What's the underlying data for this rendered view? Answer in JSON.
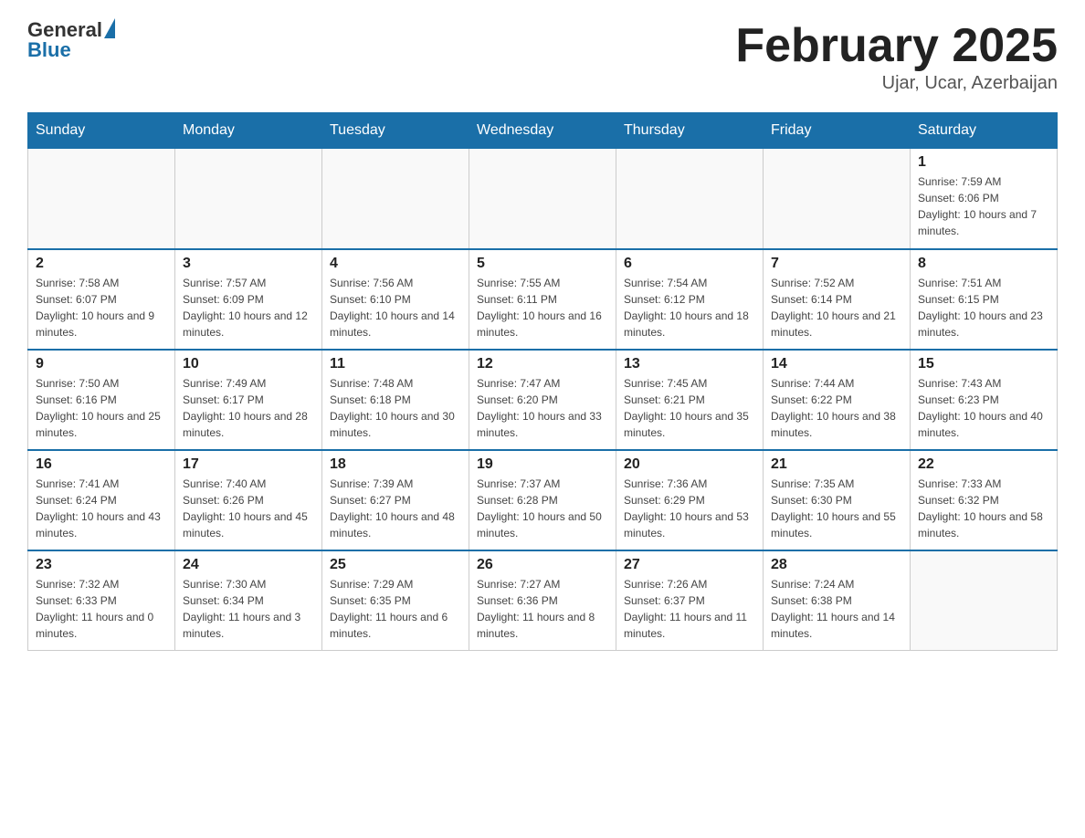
{
  "logo": {
    "general": "General",
    "blue": "Blue"
  },
  "header": {
    "title": "February 2025",
    "location": "Ujar, Ucar, Azerbaijan"
  },
  "weekdays": [
    "Sunday",
    "Monday",
    "Tuesday",
    "Wednesday",
    "Thursday",
    "Friday",
    "Saturday"
  ],
  "weeks": [
    [
      {
        "day": "",
        "info": ""
      },
      {
        "day": "",
        "info": ""
      },
      {
        "day": "",
        "info": ""
      },
      {
        "day": "",
        "info": ""
      },
      {
        "day": "",
        "info": ""
      },
      {
        "day": "",
        "info": ""
      },
      {
        "day": "1",
        "info": "Sunrise: 7:59 AM\nSunset: 6:06 PM\nDaylight: 10 hours and 7 minutes."
      }
    ],
    [
      {
        "day": "2",
        "info": "Sunrise: 7:58 AM\nSunset: 6:07 PM\nDaylight: 10 hours and 9 minutes."
      },
      {
        "day": "3",
        "info": "Sunrise: 7:57 AM\nSunset: 6:09 PM\nDaylight: 10 hours and 12 minutes."
      },
      {
        "day": "4",
        "info": "Sunrise: 7:56 AM\nSunset: 6:10 PM\nDaylight: 10 hours and 14 minutes."
      },
      {
        "day": "5",
        "info": "Sunrise: 7:55 AM\nSunset: 6:11 PM\nDaylight: 10 hours and 16 minutes."
      },
      {
        "day": "6",
        "info": "Sunrise: 7:54 AM\nSunset: 6:12 PM\nDaylight: 10 hours and 18 minutes."
      },
      {
        "day": "7",
        "info": "Sunrise: 7:52 AM\nSunset: 6:14 PM\nDaylight: 10 hours and 21 minutes."
      },
      {
        "day": "8",
        "info": "Sunrise: 7:51 AM\nSunset: 6:15 PM\nDaylight: 10 hours and 23 minutes."
      }
    ],
    [
      {
        "day": "9",
        "info": "Sunrise: 7:50 AM\nSunset: 6:16 PM\nDaylight: 10 hours and 25 minutes."
      },
      {
        "day": "10",
        "info": "Sunrise: 7:49 AM\nSunset: 6:17 PM\nDaylight: 10 hours and 28 minutes."
      },
      {
        "day": "11",
        "info": "Sunrise: 7:48 AM\nSunset: 6:18 PM\nDaylight: 10 hours and 30 minutes."
      },
      {
        "day": "12",
        "info": "Sunrise: 7:47 AM\nSunset: 6:20 PM\nDaylight: 10 hours and 33 minutes."
      },
      {
        "day": "13",
        "info": "Sunrise: 7:45 AM\nSunset: 6:21 PM\nDaylight: 10 hours and 35 minutes."
      },
      {
        "day": "14",
        "info": "Sunrise: 7:44 AM\nSunset: 6:22 PM\nDaylight: 10 hours and 38 minutes."
      },
      {
        "day": "15",
        "info": "Sunrise: 7:43 AM\nSunset: 6:23 PM\nDaylight: 10 hours and 40 minutes."
      }
    ],
    [
      {
        "day": "16",
        "info": "Sunrise: 7:41 AM\nSunset: 6:24 PM\nDaylight: 10 hours and 43 minutes."
      },
      {
        "day": "17",
        "info": "Sunrise: 7:40 AM\nSunset: 6:26 PM\nDaylight: 10 hours and 45 minutes."
      },
      {
        "day": "18",
        "info": "Sunrise: 7:39 AM\nSunset: 6:27 PM\nDaylight: 10 hours and 48 minutes."
      },
      {
        "day": "19",
        "info": "Sunrise: 7:37 AM\nSunset: 6:28 PM\nDaylight: 10 hours and 50 minutes."
      },
      {
        "day": "20",
        "info": "Sunrise: 7:36 AM\nSunset: 6:29 PM\nDaylight: 10 hours and 53 minutes."
      },
      {
        "day": "21",
        "info": "Sunrise: 7:35 AM\nSunset: 6:30 PM\nDaylight: 10 hours and 55 minutes."
      },
      {
        "day": "22",
        "info": "Sunrise: 7:33 AM\nSunset: 6:32 PM\nDaylight: 10 hours and 58 minutes."
      }
    ],
    [
      {
        "day": "23",
        "info": "Sunrise: 7:32 AM\nSunset: 6:33 PM\nDaylight: 11 hours and 0 minutes."
      },
      {
        "day": "24",
        "info": "Sunrise: 7:30 AM\nSunset: 6:34 PM\nDaylight: 11 hours and 3 minutes."
      },
      {
        "day": "25",
        "info": "Sunrise: 7:29 AM\nSunset: 6:35 PM\nDaylight: 11 hours and 6 minutes."
      },
      {
        "day": "26",
        "info": "Sunrise: 7:27 AM\nSunset: 6:36 PM\nDaylight: 11 hours and 8 minutes."
      },
      {
        "day": "27",
        "info": "Sunrise: 7:26 AM\nSunset: 6:37 PM\nDaylight: 11 hours and 11 minutes."
      },
      {
        "day": "28",
        "info": "Sunrise: 7:24 AM\nSunset: 6:38 PM\nDaylight: 11 hours and 14 minutes."
      },
      {
        "day": "",
        "info": ""
      }
    ]
  ]
}
